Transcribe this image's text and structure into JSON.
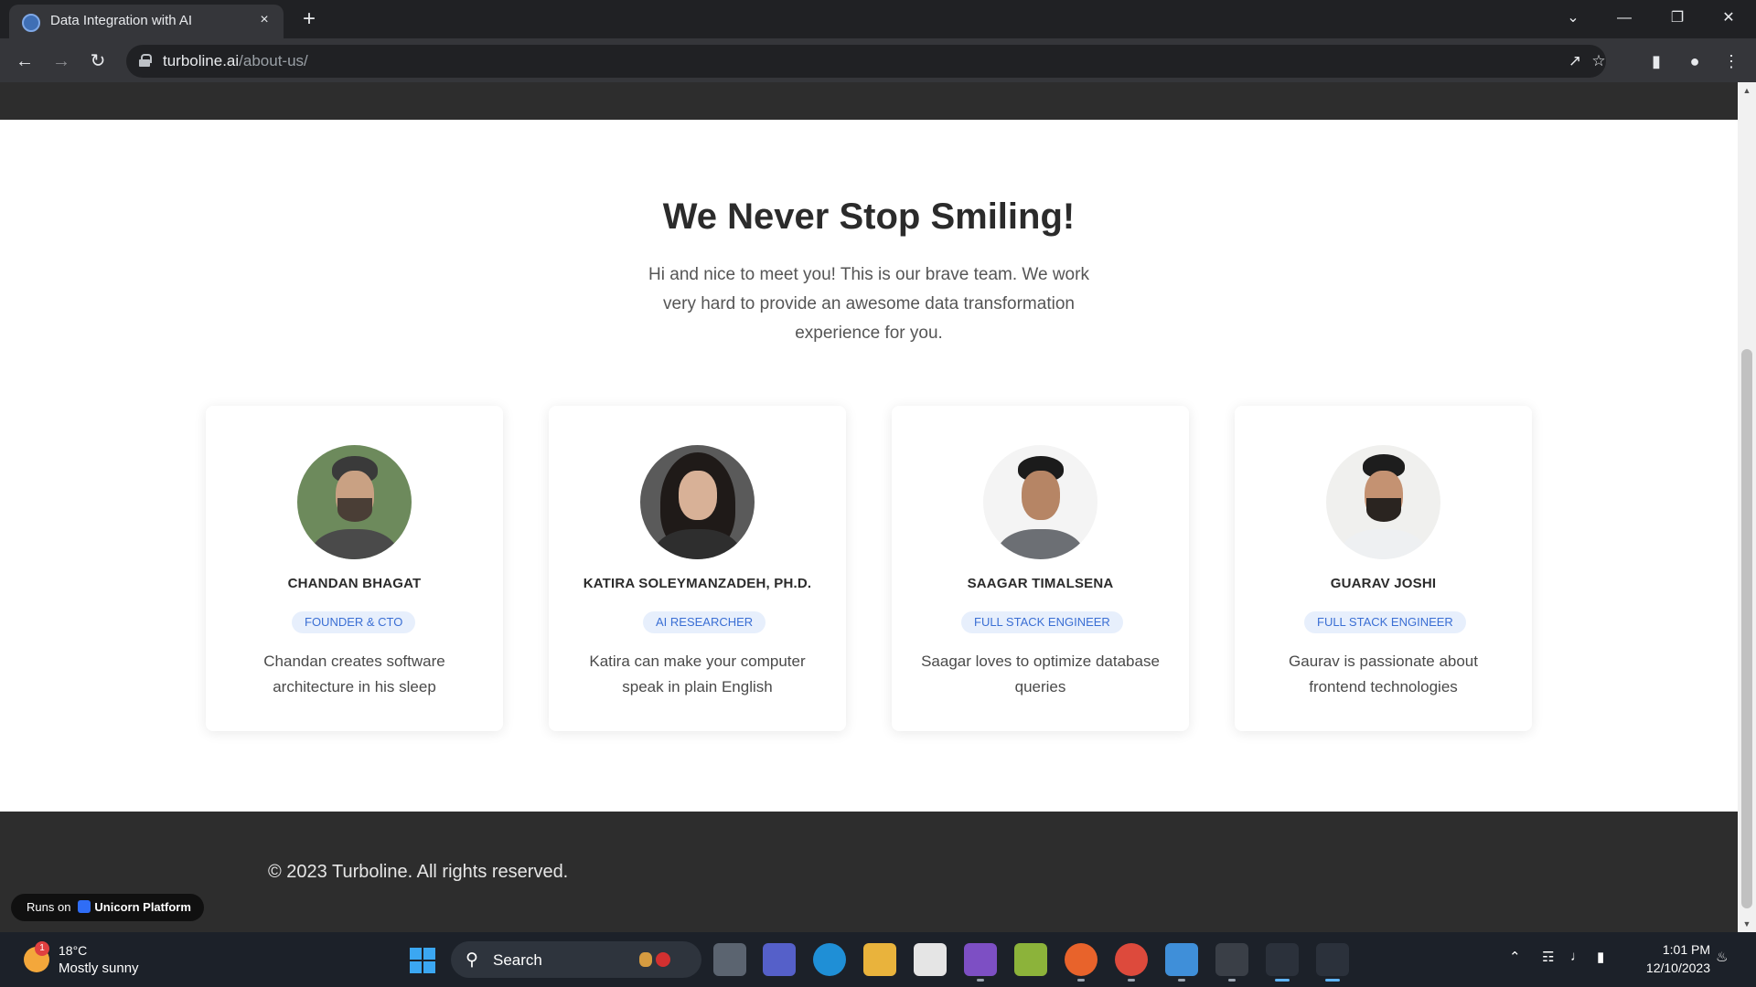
{
  "browser": {
    "tab_title": "Data Integration with AI",
    "url_domain": "turboline.ai",
    "url_path": "/about-us/",
    "new_tab_icon": "+",
    "close_icon": "×"
  },
  "page": {
    "heading": "We Never Stop Smiling!",
    "intro": "Hi and nice to meet you! This is our brave team. We work very hard to provide an awesome data transformation experience for you.",
    "team": [
      {
        "name": "CHANDAN BHAGAT",
        "role": "FOUNDER & CTO",
        "description": "Chandan creates software architecture in his sleep"
      },
      {
        "name": "KATIRA SOLEYMANZADEH, PH.D.",
        "role": "AI RESEARCHER",
        "description": "Katira can make your computer speak in plain English"
      },
      {
        "name": "SAAGAR TIMALSENA",
        "role": "FULL STACK ENGINEER",
        "description": "Saagar loves to optimize database queries"
      },
      {
        "name": "GUARAV JOSHI",
        "role": "FULL STACK ENGINEER",
        "description": "Gaurav is passionate about frontend technologies"
      }
    ],
    "footer": {
      "copyright": "© 2023 Turboline. All rights reserved."
    },
    "badge": {
      "prefix": "Runs on",
      "platform": "Unicorn Platform"
    }
  },
  "taskbar": {
    "weather_badge": "1",
    "temperature": "18°C",
    "condition": "Mostly sunny",
    "search_label": "Search",
    "time": "1:01 PM",
    "date": "12/10/2023"
  },
  "colors": {
    "accent": "#3b6fd4",
    "role_badge_bg": "#e7effc",
    "dark_band": "#2d2d2d"
  }
}
